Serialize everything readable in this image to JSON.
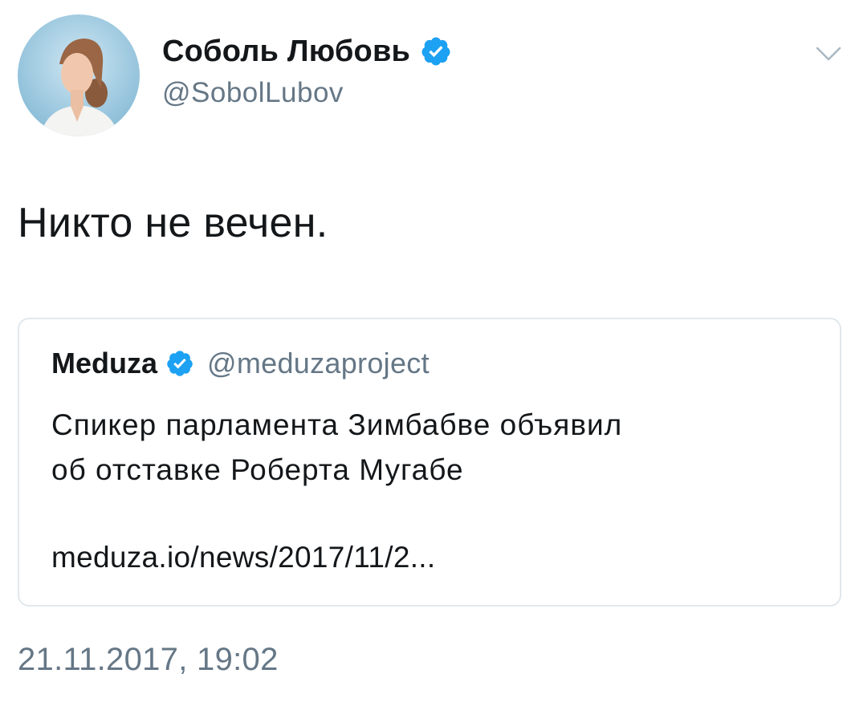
{
  "author": {
    "name": "Соболь Любовь",
    "handle": "@SobolLubov",
    "verified": true,
    "avatar_icon": "profile-photo"
  },
  "tweet": {
    "text": "Никто не вечен.",
    "timestamp": "21.11.2017, 19:02"
  },
  "quoted_tweet": {
    "name": "Meduza",
    "handle": "@meduzaproject",
    "verified": true,
    "text_line1": "Спикер парламента Зимбабве объявил",
    "text_line2": "об отставке Роберта Мугабе",
    "link": "meduza.io/news/2017/11/2..."
  },
  "icons": {
    "verified": "verified-badge-icon",
    "menu": "chevron-down-icon"
  },
  "colors": {
    "verified": "#1da1f2",
    "text": "#14171a",
    "secondary": "#657786",
    "border": "#e1e8ed"
  }
}
